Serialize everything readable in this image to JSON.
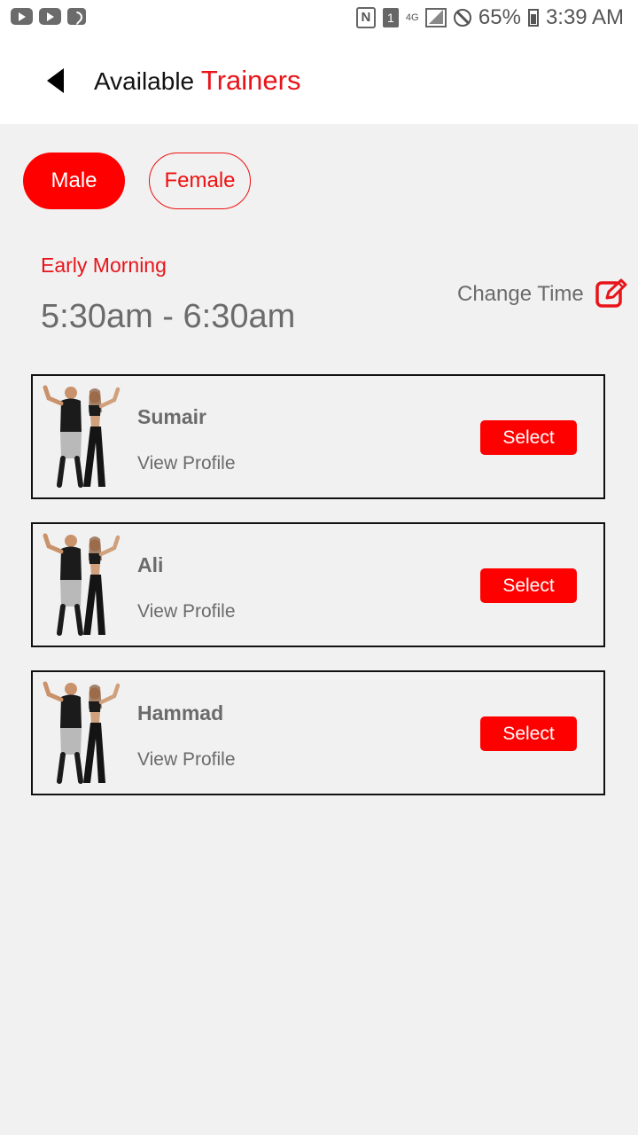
{
  "status_bar": {
    "battery": "65%",
    "time": "3:39 AM",
    "sim_slot": "1",
    "network": "4G",
    "icons": [
      "youtube-icon",
      "youtube-icon",
      "wifi-icon",
      "nfc-icon",
      "sim-icon",
      "signal-icon",
      "do-not-disturb-icon",
      "battery-icon"
    ]
  },
  "header": {
    "title_plain": "Available",
    "title_accent": "Trainers",
    "back_icon": "back-arrow-icon"
  },
  "gender": {
    "male_label": "Male",
    "female_label": "Female",
    "selected": "Male"
  },
  "slot": {
    "label": "Early Morning",
    "time": "5:30am - 6:30am",
    "change_label": "Change Time",
    "change_icon": "edit-icon"
  },
  "trainers": [
    {
      "name": "Sumair",
      "profile_label": "View Profile",
      "select_label": "Select"
    },
    {
      "name": "Ali",
      "profile_label": "View Profile",
      "select_label": "Select"
    },
    {
      "name": "Hammad",
      "profile_label": "View Profile",
      "select_label": "Select"
    }
  ],
  "colors": {
    "accent": "#ff0000",
    "accent_text": "#e8141a",
    "background": "#f1f1f1",
    "muted_text": "#6b6b6b"
  }
}
